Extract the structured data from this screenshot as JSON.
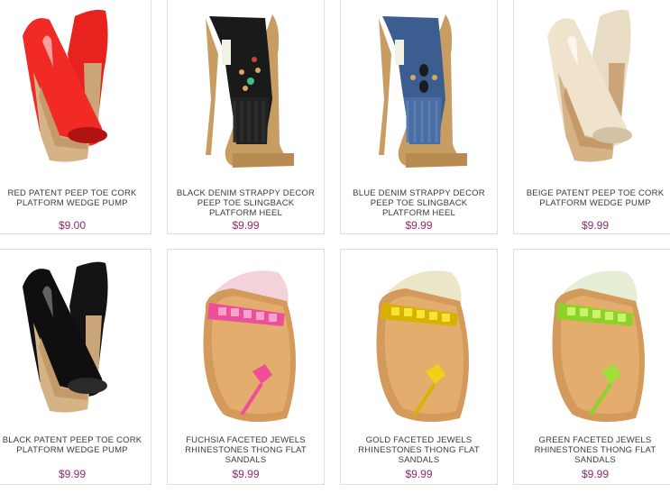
{
  "colors": {
    "price": "#8a2a6e",
    "name_text": "#3a3a3a",
    "card_border": "#dcdcdc",
    "background": "#ffffff"
  },
  "products": [
    {
      "name": "RED PATENT PEEP TOE CORK PLATFORM WEDGE PUMP",
      "price": "$9.00",
      "image_icon": "red-wedge-pump-image",
      "color": "#ee2a2a"
    },
    {
      "name": "BLACK DENIM STRAPPY DECOR PEEP TOE SLINGBACK PLATFORM HEEL",
      "price": "$9.99",
      "image_icon": "black-strappy-platform-heel-image",
      "color": "#1a1a1a"
    },
    {
      "name": "BLUE DENIM STRAPPY DECOR PEEP TOE SLINGBACK PLATFORM HEEL",
      "price": "$9.99",
      "image_icon": "blue-strappy-platform-heel-image",
      "color": "#3f5f8f"
    },
    {
      "name": "BEIGE PATENT PEEP TOE CORK PLATFORM WEDGE PUMP",
      "price": "$9.99",
      "image_icon": "beige-wedge-pump-image",
      "color": "#eedfc6"
    },
    {
      "name": "BLACK PATENT PEEP TOE CORK PLATFORM WEDGE PUMP",
      "price": "$9.99",
      "image_icon": "black-wedge-pump-image",
      "color": "#121212"
    },
    {
      "name": "FUCHSIA FACETED JEWELS RHINESTONES THONG FLAT SANDALS",
      "price": "$9.99",
      "image_icon": "fuchsia-thong-sandal-image",
      "color": "#ee4f9a"
    },
    {
      "name": "GOLD FACETED JEWELS RHINESTONES THONG FLAT SANDALS",
      "price": "$9.99",
      "image_icon": "gold-thong-sandal-image",
      "color": "#f2d019"
    },
    {
      "name": "GREEN FACETED JEWELS RHINESTONES THONG FLAT SANDALS",
      "price": "$9.99",
      "image_icon": "green-thong-sandal-image",
      "color": "#9fe03a"
    }
  ]
}
